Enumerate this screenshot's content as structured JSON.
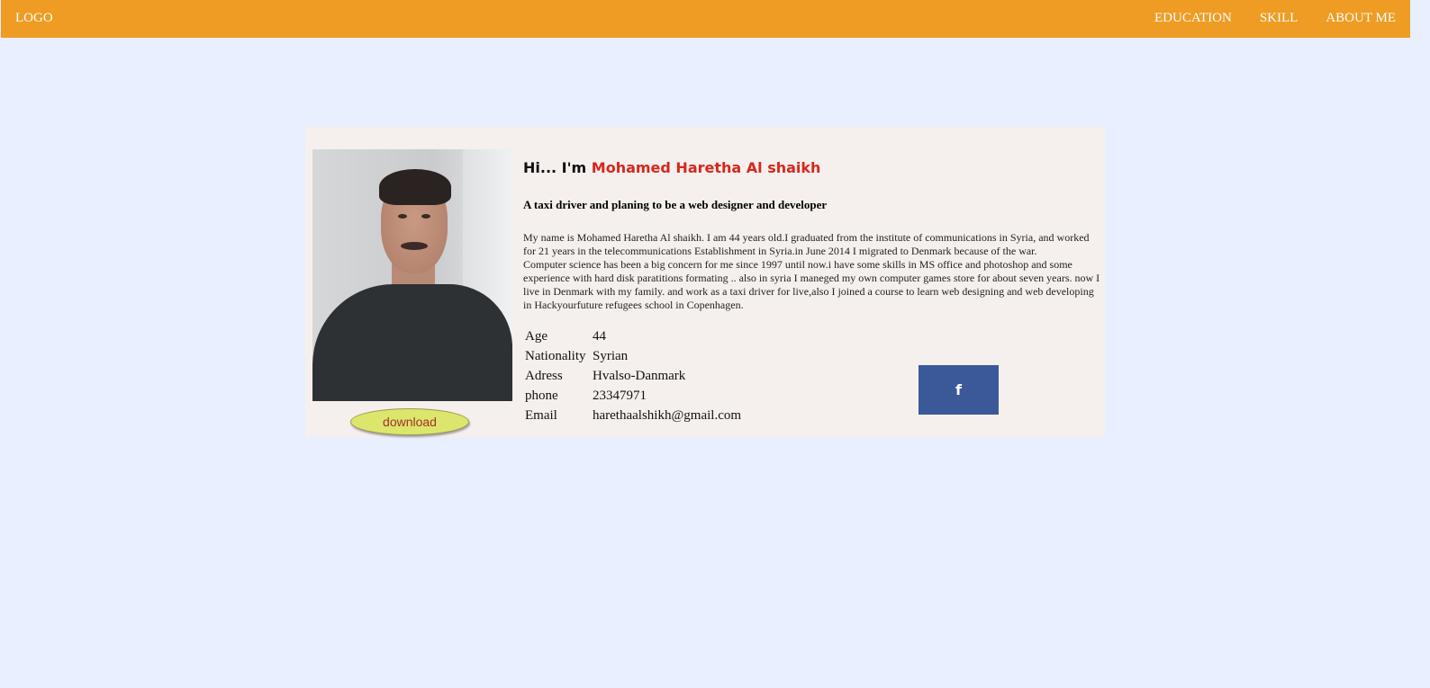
{
  "navbar": {
    "logo": "LOGO",
    "links": [
      "EDUCATION",
      "SKILL",
      "ABOUT ME"
    ]
  },
  "profile": {
    "greeting": "Hi... I'm ",
    "name": "Mohamed Haretha Al shaikh",
    "subtitle": "A taxi driver and planing to be a web designer and developer",
    "bio": [
      "My name is Mohamed Haretha Al shaikh. I am 44 years old.I graduated from the institute of communications in Syria, and worked for 21 years in the telecommunications Establishment in Syria.in June 2014 I migrated to Denmark because of the war.",
      "Computer science has been a big concern for me since 1997 until now.i have some skills in MS office and photoshop and some experience with hard disk paratitions formating .. also in syria I maneged my own computer games store for about seven years. now I live in Denmark with my family. and work as a taxi driver for live,also I joined a course to learn web designing and web developing in Hackyourfuture refugees school in Copenhagen."
    ],
    "download_label": "download",
    "info": [
      {
        "label": "Age",
        "value": "44"
      },
      {
        "label": "Nationality",
        "value": "Syrian"
      },
      {
        "label": "Adress",
        "value": "Hvalso-Danmark"
      },
      {
        "label": "phone",
        "value": "23347971"
      },
      {
        "label": "Email",
        "value": "harethaalshikh@gmail.com"
      }
    ],
    "facebook_icon": "f",
    "colors": {
      "navbar": "#ee9c23",
      "name": "#d5281c",
      "facebook": "#3b5998",
      "download": "#dce66c"
    }
  }
}
